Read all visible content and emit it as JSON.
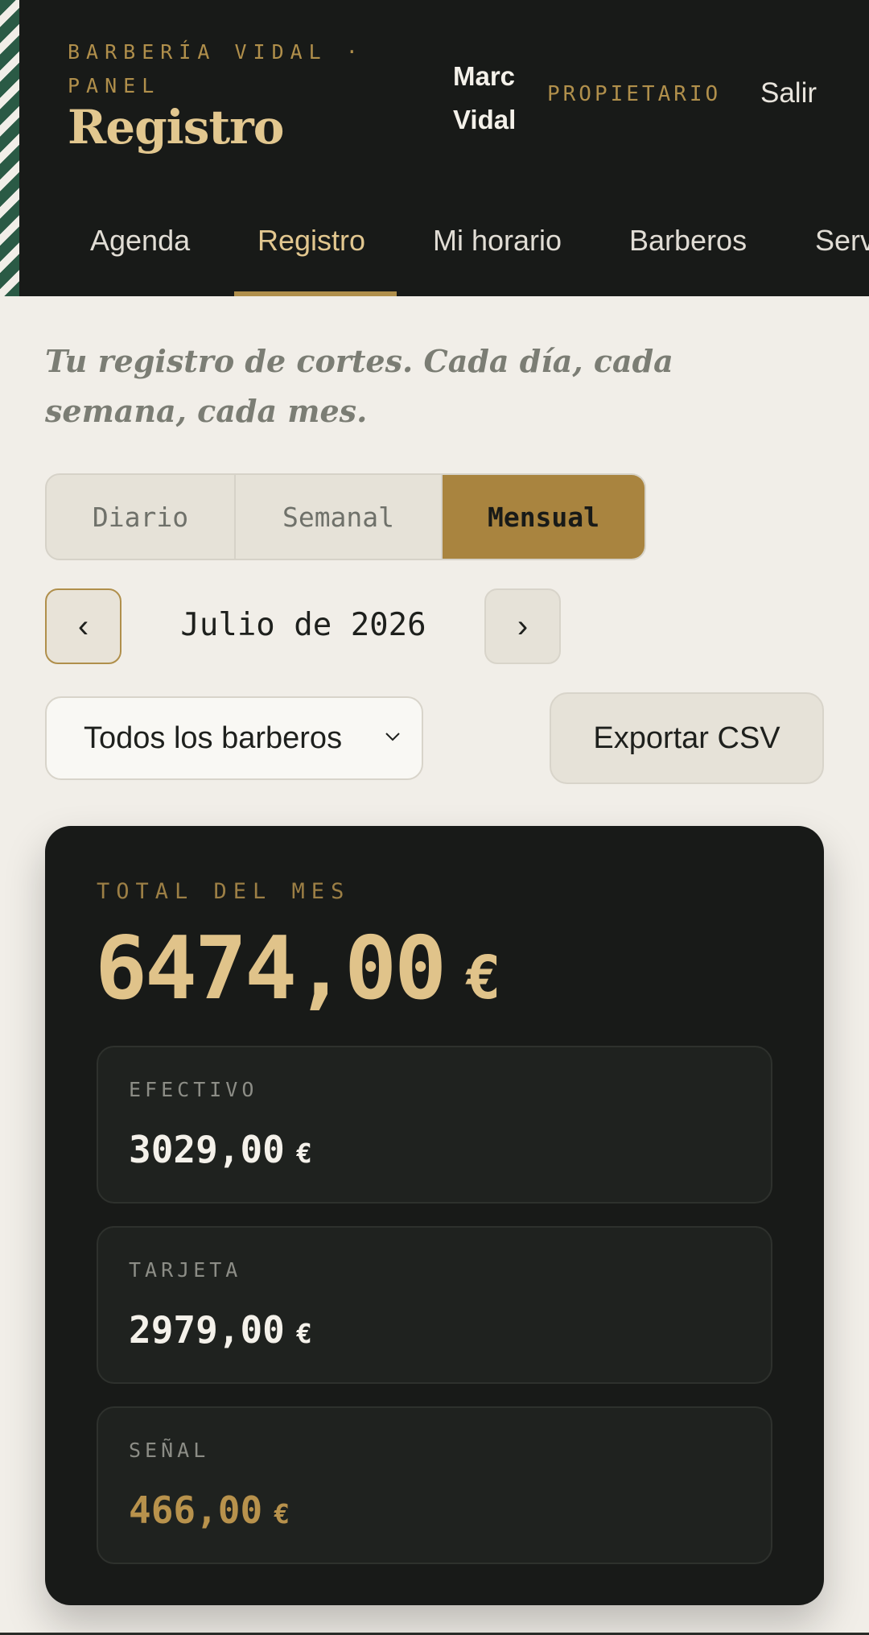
{
  "header": {
    "eyebrow": "BARBERÍA VIDAL · PANEL",
    "title": "Registro",
    "user_name": "Marc Vidal",
    "user_role": "PROPIETARIO",
    "logout_label": "Salir"
  },
  "nav": {
    "tabs": [
      {
        "label": "Agenda",
        "active": false
      },
      {
        "label": "Registro",
        "active": true
      },
      {
        "label": "Mi horario",
        "active": false
      },
      {
        "label": "Barberos",
        "active": false
      },
      {
        "label": "Serv",
        "active": false
      }
    ]
  },
  "page": {
    "tagline": "Tu registro de cortes. Cada día, cada semana, cada mes."
  },
  "period_toggle": {
    "options": [
      "Diario",
      "Semanal",
      "Mensual"
    ],
    "selected": "Mensual"
  },
  "period_nav": {
    "prev_symbol": "‹",
    "label": "Julio de 2026",
    "next_symbol": "›"
  },
  "filters": {
    "barber_select_value": "Todos los barberos",
    "export_label": "Exportar CSV"
  },
  "summary": {
    "total_label": "TOTAL DEL MES",
    "total_value": "6474,00",
    "currency": "€",
    "breakdown": [
      {
        "label": "EFECTIVO",
        "value": "3029,00"
      },
      {
        "label": "TARJETA",
        "value": "2979,00"
      },
      {
        "label": "SEÑAL",
        "value": "466,00"
      }
    ]
  },
  "colors": {
    "accent_gold": "#a9843f",
    "dark_bg": "#181a18",
    "page_bg": "#f1eee8",
    "stripe_green": "#2a5a45"
  }
}
